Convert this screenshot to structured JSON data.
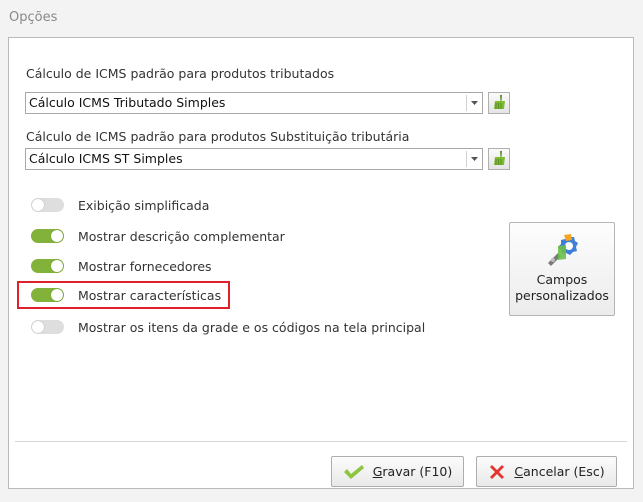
{
  "window": {
    "title": "Opções"
  },
  "icms_tributado": {
    "label": "Cálculo de ICMS padrão para produtos tributados",
    "value": "Cálculo ICMS Tributado Simples"
  },
  "icms_st": {
    "label": "Cálculo de ICMS padrão para produtos Substituição tributária",
    "value": "Cálculo ICMS ST Simples"
  },
  "toggles": [
    {
      "label": "Exibição simplificada",
      "on": false
    },
    {
      "label": "Mostrar descrição complementar",
      "on": true
    },
    {
      "label": "Mostrar fornecedores",
      "on": true
    },
    {
      "label": "Mostrar características",
      "on": true
    },
    {
      "label": "Mostrar os itens da grade e os códigos na tela principal",
      "on": false
    }
  ],
  "campos_button": {
    "line1": "Campos",
    "line2": "personalizados",
    "icon": "gear-wrench-icon"
  },
  "buttons": {
    "save": {
      "accel": "G",
      "rest": "ravar (F10)",
      "icon": "check-icon"
    },
    "cancel": {
      "accel": "C",
      "rest": "ancelar (Esc)",
      "icon": "x-icon"
    }
  },
  "colors": {
    "toggle_on": "#82b23a",
    "toggle_off": "#dedede",
    "highlight": "#e0202a"
  }
}
